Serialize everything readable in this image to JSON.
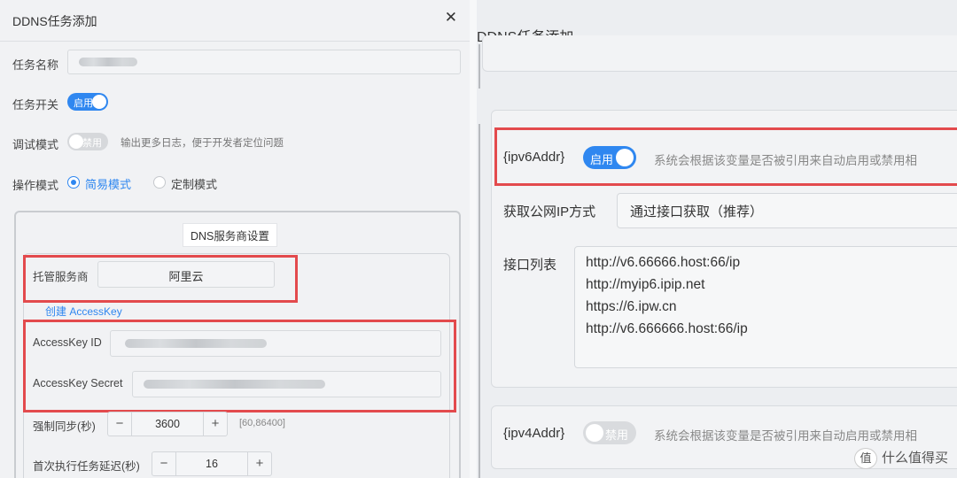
{
  "left": {
    "title": "DDNS任务添加",
    "close_glyph": "✕",
    "task_name_label": "任务名称",
    "task_switch_label": "任务开关",
    "task_switch_state": "启用",
    "debug_label": "调试模式",
    "debug_state": "禁用",
    "debug_hint": "输出更多日志，便于开发者定位问题",
    "mode_label": "操作模式",
    "mode_options": [
      "简易模式",
      "定制模式"
    ],
    "dns_section_title": "DNS服务商设置",
    "provider_label": "托管服务商",
    "provider_value": "阿里云",
    "create_accesskey_link": "创建 AccessKey",
    "accesskey_id_label": "AccessKey ID",
    "accesskey_secret_label": "AccessKey Secret",
    "force_sync_label": "强制同步(秒)",
    "force_sync_value": "3600",
    "force_sync_range": "[60,86400]",
    "first_delay_label": "首次执行任务延迟(秒)",
    "first_delay_value": "16",
    "minus_glyph": "−",
    "plus_glyph": "+"
  },
  "right": {
    "title": "DDNS任务添加",
    "ipv6": {
      "var_label": "{ipv6Addr}",
      "state": "启用",
      "hint": "系统会根据该变量是否被引用来自动启用或禁用相"
    },
    "fetch_method_label": "获取公网IP方式",
    "fetch_method_value": "通过接口获取（推荐）",
    "interface_list_label": "接口列表",
    "interfaces": [
      "http://v6.66666.host:66/ip",
      "http://myip6.ipip.net",
      "https://6.ipw.cn",
      "http://v6.666666.host:66/ip"
    ],
    "ipv4": {
      "var_label": "{ipv4Addr}",
      "state": "禁用",
      "hint": "系统会根据该变量是否被引用来自动启用或禁用相"
    }
  },
  "watermark": {
    "badge": "值",
    "text": "什么值得买"
  },
  "colors": {
    "accent": "#2f87f0",
    "highlight_red": "#e34a4d"
  }
}
